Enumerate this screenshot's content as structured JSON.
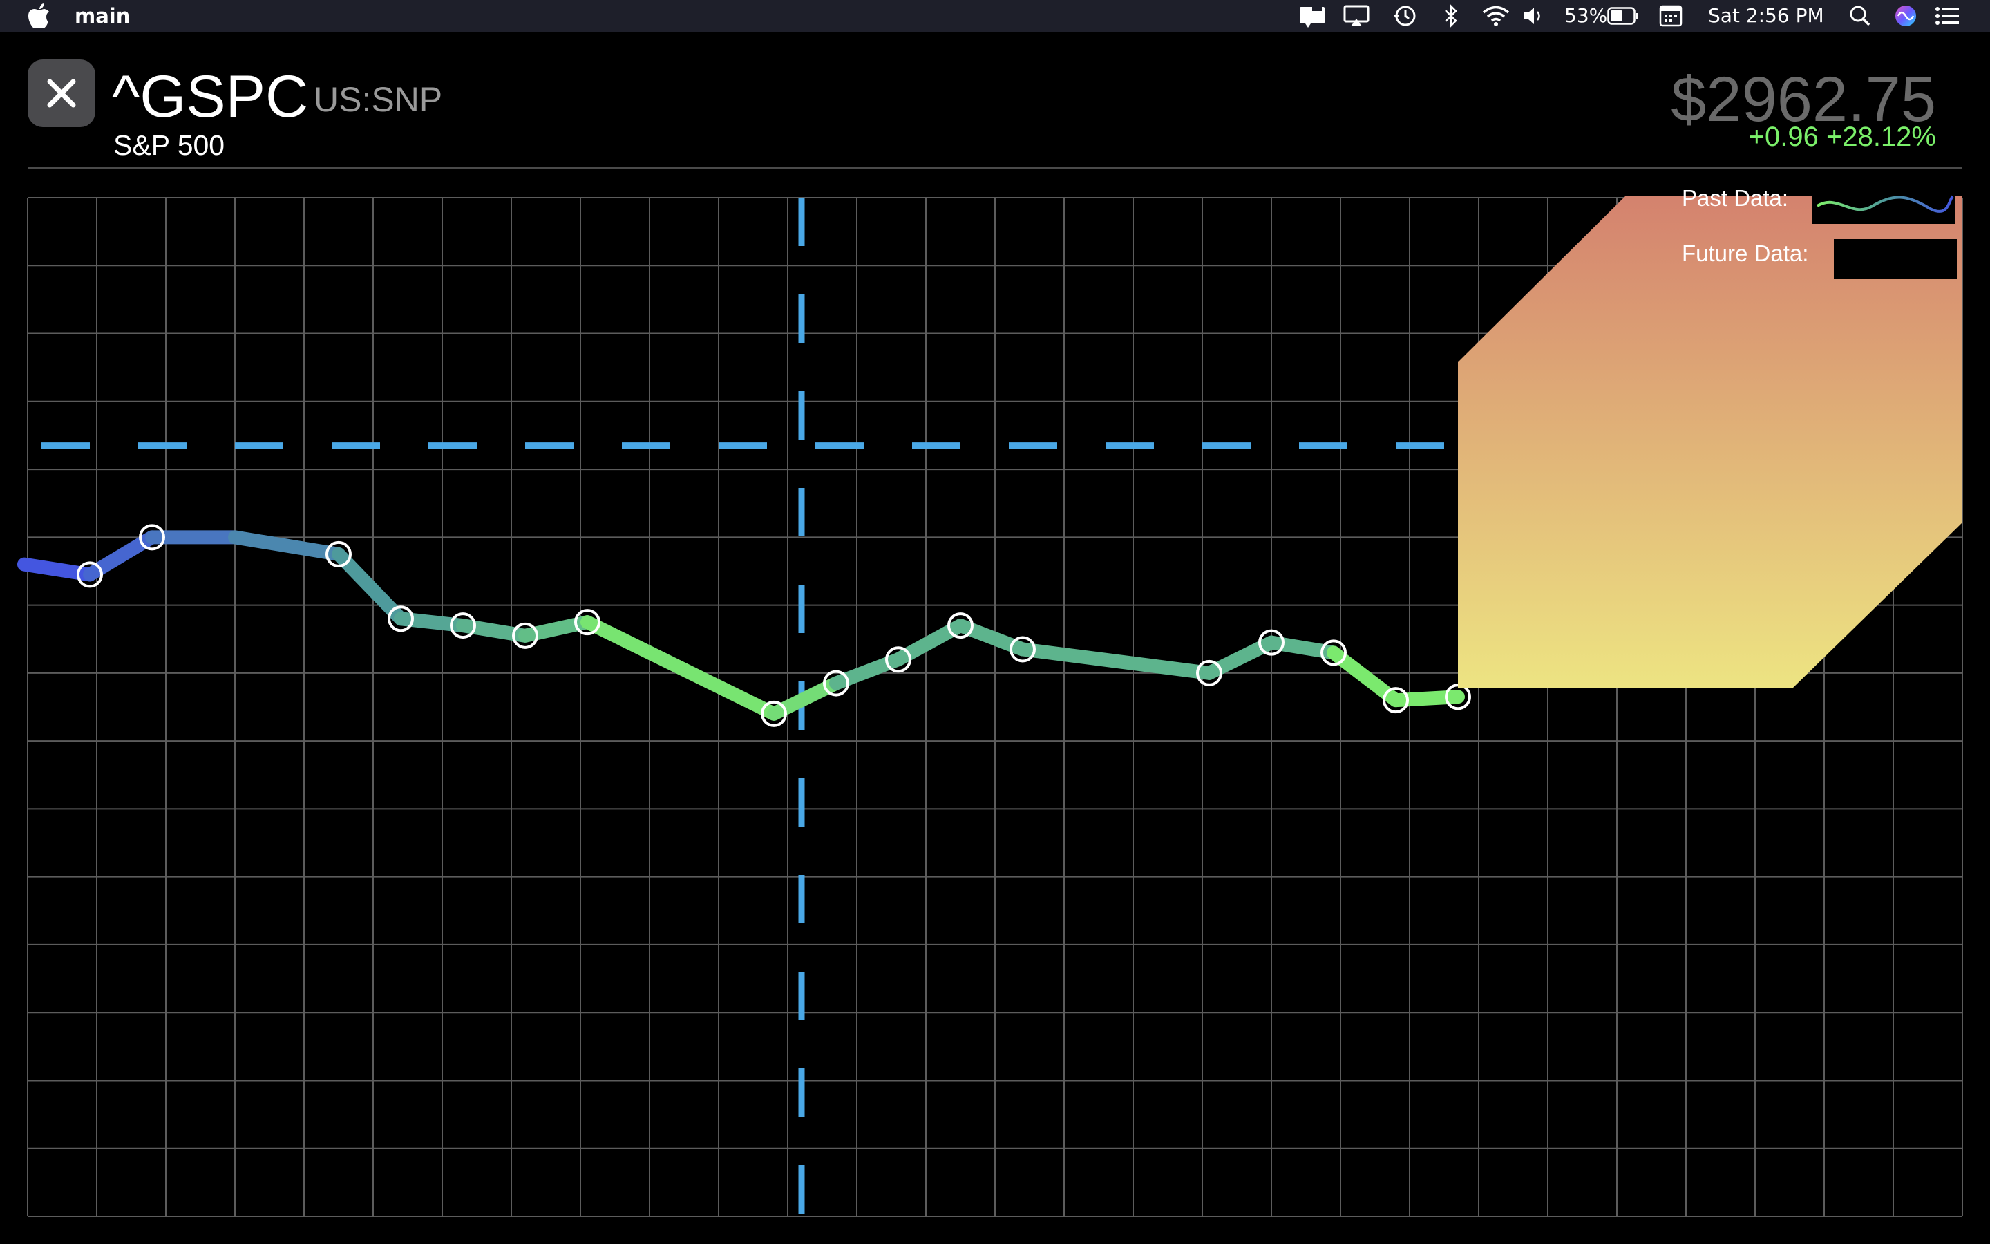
{
  "menubar": {
    "app_name": "main",
    "battery_percent": "53%",
    "clock": "Sat 2:56 PM",
    "icons": [
      "apple-icon",
      "notification-icon",
      "airplay-icon",
      "time-machine-icon",
      "bluetooth-icon",
      "wifi-icon",
      "volume-icon",
      "battery-icon",
      "input-menu-icon",
      "spotlight-icon",
      "siri-icon",
      "control-center-icon"
    ]
  },
  "header": {
    "close_icon": "close-icon",
    "ticker": "^GSPC",
    "exchange": "US:SNP",
    "name": "S&P 500",
    "price": "$2962.75",
    "change": "+0.96 +28.12%"
  },
  "colors": {
    "price_grey": "#6a6a6a",
    "change_green": "#7bf06a",
    "crosshair_blue": "#4aa8e6",
    "past_start_blue": "#4456e0",
    "past_mid_teal": "#4e9a9c",
    "past_end_green": "#7ff06a",
    "overlay_top": "#d4826e",
    "overlay_bottom": "#ede482"
  },
  "legend": {
    "past_label": "Past Data:",
    "future_label": "Future Data:"
  },
  "chart_data": {
    "type": "line",
    "title": "",
    "xlabel": "",
    "ylabel": "",
    "grid": true,
    "x_columns": 28,
    "y_rows": 15,
    "xlim": [
      0,
      28
    ],
    "ylim": [
      0,
      15
    ],
    "crosshair": {
      "x": 11.2,
      "y": 11.35
    },
    "series": [
      {
        "points": [
          {
            "x": -0.05,
            "y": 9.6,
            "marker": false
          },
          {
            "x": 0.9,
            "y": 9.45,
            "marker": true
          },
          {
            "x": 1.8,
            "y": 10.0,
            "marker": true
          },
          {
            "x": 3.0,
            "y": 10.0,
            "marker": false
          },
          {
            "x": 4.5,
            "y": 9.75,
            "marker": true
          },
          {
            "x": 5.4,
            "y": 8.8,
            "marker": true
          },
          {
            "x": 6.3,
            "y": 8.7,
            "marker": true
          },
          {
            "x": 7.2,
            "y": 8.55,
            "marker": true
          },
          {
            "x": 8.1,
            "y": 8.75,
            "marker": true
          },
          {
            "x": 10.8,
            "y": 7.4,
            "marker": true
          },
          {
            "x": 11.7,
            "y": 7.85,
            "marker": true
          },
          {
            "x": 12.6,
            "y": 8.2,
            "marker": true
          },
          {
            "x": 13.5,
            "y": 8.7,
            "marker": true
          },
          {
            "x": 14.4,
            "y": 8.35,
            "marker": true
          },
          {
            "x": 17.1,
            "y": 8.0,
            "marker": true
          },
          {
            "x": 18.0,
            "y": 8.45,
            "marker": true
          },
          {
            "x": 18.9,
            "y": 8.3,
            "marker": true
          },
          {
            "x": 19.8,
            "y": 7.6,
            "marker": true
          },
          {
            "x": 20.7,
            "y": 7.65,
            "marker": true
          }
        ]
      }
    ]
  }
}
